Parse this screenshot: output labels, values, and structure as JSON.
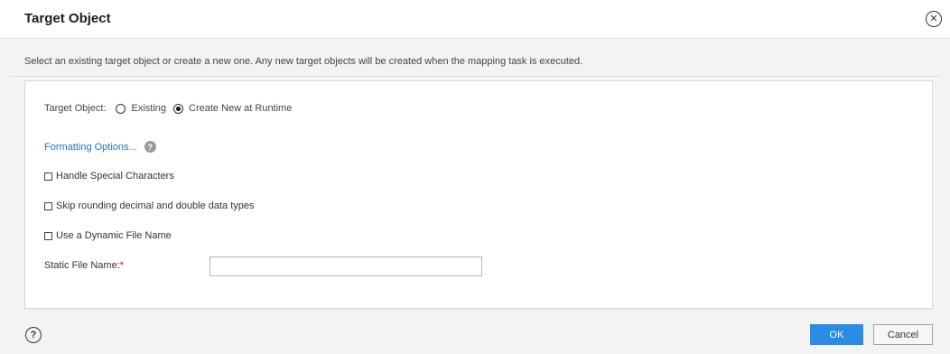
{
  "dialog": {
    "title": "Target Object",
    "close_icon": "close-circle-icon",
    "description": "Select an existing target object or create a new one. Any new target objects will be created when the mapping task is executed."
  },
  "target_object": {
    "label": "Target Object:",
    "options": [
      {
        "label": "Existing",
        "selected": false
      },
      {
        "label": "Create New at Runtime",
        "selected": true
      }
    ]
  },
  "formatting": {
    "link_label": "Formatting Options...",
    "help_icon": "question-icon",
    "help_glyph": "?"
  },
  "checkboxes": [
    {
      "label": "Handle Special Characters",
      "checked": false
    },
    {
      "label": "Skip rounding decimal and double data types",
      "checked": false
    },
    {
      "label": "Use a Dynamic File Name",
      "checked": false
    }
  ],
  "static_file_name": {
    "label": "Static File Name:",
    "required_marker": "*",
    "value": ""
  },
  "footer": {
    "help_glyph": "?",
    "ok_label": "OK",
    "cancel_label": "Cancel"
  },
  "colors": {
    "accent": "#2b8ce6",
    "link": "#2a6fc9",
    "required": "#d0021b"
  }
}
